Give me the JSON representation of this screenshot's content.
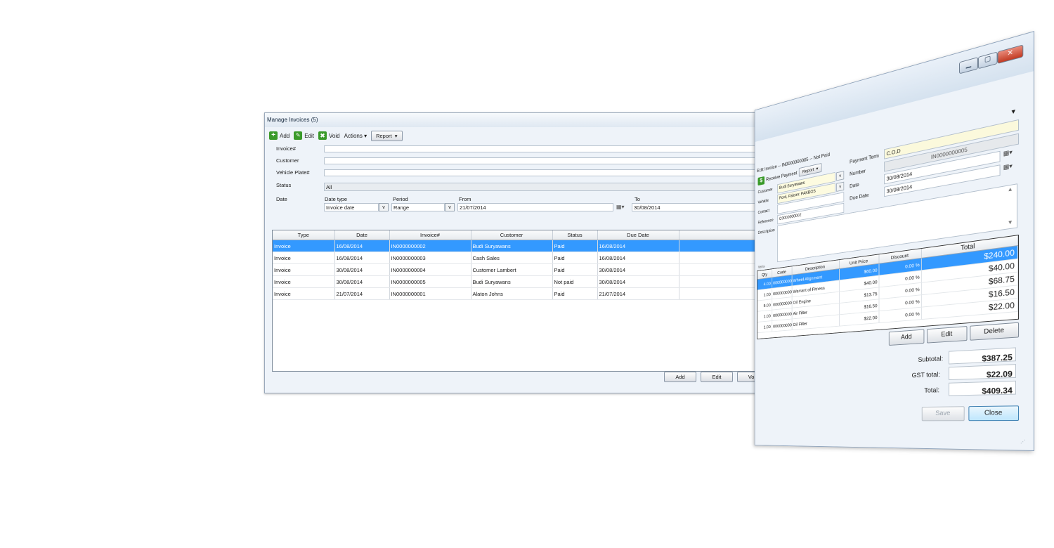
{
  "manage": {
    "title": "Manage Invoices (5)",
    "toolbar": {
      "add": "Add",
      "edit": "Edit",
      "void": "Void",
      "actions": "Actions",
      "report": "Report"
    },
    "filters": {
      "invoice_label": "Invoice#",
      "customer_label": "Customer",
      "plate_label": "Vehicle Plate#",
      "status_label": "Status",
      "status_value": "All",
      "date_label": "Date",
      "date_type_label": "Date type",
      "date_type_value": "Invoice date",
      "period_label": "Period",
      "period_value": "Range",
      "from_label": "From",
      "from_value": "21/07/2014",
      "to_label": "To",
      "to_value": "30/08/2014"
    },
    "grid": {
      "columns": [
        "Type",
        "Date",
        "Invoice#",
        "Customer",
        "Status",
        "Due Date"
      ],
      "rows": [
        [
          "Invoice",
          "16/08/2014",
          "IN0000000002",
          "Budi Suryawans",
          "Paid",
          "16/08/2014"
        ],
        [
          "Invoice",
          "16/08/2014",
          "IN0000000003",
          "Cash Sales",
          "Paid",
          "16/08/2014"
        ],
        [
          "Invoice",
          "30/08/2014",
          "IN0000000004",
          "Customer Lambert",
          "Paid",
          "30/08/2014"
        ],
        [
          "Invoice",
          "30/08/2014",
          "IN0000000005",
          "Budi Suryawans",
          "Not paid",
          "30/08/2014"
        ],
        [
          "Invoice",
          "21/07/2014",
          "IN0000000001",
          "Alaton Johns",
          "Paid",
          "21/07/2014"
        ]
      ],
      "selected_row": 0
    },
    "buttons": {
      "add": "Add",
      "edit": "Edit",
      "void": "Void"
    }
  },
  "edit": {
    "title": "Edit Invoice -- IN0000000005 -- Not Paid",
    "toolbar": {
      "receive_payment": "Receive Payment",
      "report": "Report"
    },
    "customer_label": "Customer",
    "customer_value": "Budi Suryawans",
    "vehicle_label": "Vehicle",
    "vehicle_value": "Ford, Falcon: PAKBOS",
    "contact_label": "Contact",
    "reference_label": "Reference",
    "reference_value": "C0000000002",
    "description_label": "Description",
    "payment_term_label": "Payment Term",
    "payment_term_value": "C.O.D",
    "number_label": "Number",
    "number_value": "IN0000000005",
    "date_label": "Date",
    "date_value": "30/08/2014",
    "due_date_label": "Due Date",
    "due_date_value": "30/08/2014",
    "items_label": "Items",
    "items": {
      "columns": [
        "Qty",
        "Code",
        "Description",
        "Unit Price",
        "Discount",
        "Total"
      ],
      "rows": [
        [
          "4.00",
          "0000000002",
          "Wheel Alignment",
          "$60.00",
          "0.00 %",
          "$240.00"
        ],
        [
          "1.00",
          "0000000003",
          "Warrant of Fitness",
          "$40.00",
          "0.00 %",
          "$40.00"
        ],
        [
          "5.00",
          "0000000004",
          "Oil Engine",
          "$13.75",
          "0.00 %",
          "$68.75"
        ],
        [
          "1.00",
          "0000000005",
          "Air Filter",
          "$16.50",
          "0.00 %",
          "$16.50"
        ],
        [
          "1.00",
          "0000000006",
          "Oil Filter",
          "$22.00",
          "0.00 %",
          "$22.00"
        ]
      ],
      "selected_row": 0
    },
    "item_buttons": {
      "add": "Add",
      "edit": "Edit",
      "delete": "Delete"
    },
    "subtotal_label": "Subtotal:",
    "subtotal_value": "$387.25",
    "gst_label": "GST total:",
    "gst_value": "$22.09",
    "total_label": "Total:",
    "total_value": "$409.34",
    "save": "Save",
    "close": "Close"
  }
}
